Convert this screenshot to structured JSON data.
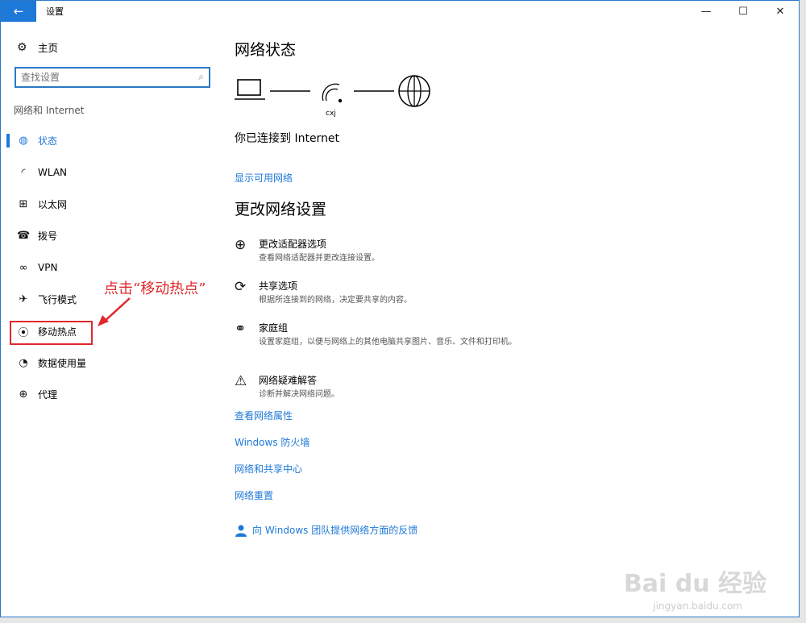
{
  "window": {
    "title": "设置",
    "back": "←",
    "minimize": "—",
    "maximize": "☐",
    "close": "✕"
  },
  "sidebar": {
    "home": "主页",
    "search_placeholder": "查找设置",
    "section": "网络和 Internet",
    "items": [
      {
        "label": "状态",
        "icon": "globe-icon",
        "glyph": "◍",
        "active": true
      },
      {
        "label": "WLAN",
        "icon": "wifi-icon",
        "glyph": "◜",
        "active": false
      },
      {
        "label": "以太网",
        "icon": "ethernet-icon",
        "glyph": "⊞",
        "active": false
      },
      {
        "label": "拨号",
        "icon": "dialup-icon",
        "glyph": "☎",
        "active": false
      },
      {
        "label": "VPN",
        "icon": "vpn-icon",
        "glyph": "∞",
        "active": false
      },
      {
        "label": "飞行模式",
        "icon": "airplane-icon",
        "glyph": "✈",
        "active": false
      },
      {
        "label": "移动热点",
        "icon": "hotspot-icon",
        "glyph": "⦿",
        "active": false
      },
      {
        "label": "数据使用量",
        "icon": "data-usage-icon",
        "glyph": "◔",
        "active": false
      },
      {
        "label": "代理",
        "icon": "proxy-icon",
        "glyph": "⊕",
        "active": false
      }
    ]
  },
  "annotation": {
    "text": "点击“移动热点”"
  },
  "main": {
    "status_title": "网络状态",
    "wifi_name": "cxj",
    "connected_text": "你已连接到 Internet",
    "show_networks": "显示可用网络",
    "change_title": "更改网络设置",
    "settings": [
      {
        "title": "更改适配器选项",
        "desc": "查看网络适配器并更改连接设置。",
        "icon": "adapter-icon",
        "glyph": "⊕"
      },
      {
        "title": "共享选项",
        "desc": "根据所连接到的网络，决定要共享的内容。",
        "icon": "sharing-icon",
        "glyph": "⟳"
      },
      {
        "title": "家庭组",
        "desc": "设置家庭组，以便与网络上的其他电脑共享图片、音乐、文件和打印机。",
        "icon": "homegroup-icon",
        "glyph": "⚭"
      },
      {
        "title": "网络疑难解答",
        "desc": "诊断并解决网络问题。",
        "icon": "warning-icon",
        "glyph": "⚠"
      }
    ],
    "links": [
      "查看网络属性",
      "Windows 防火墙",
      "网络和共享中心",
      "网络重置"
    ],
    "feedback": "向 Windows 团队提供网络方面的反馈"
  },
  "watermark": {
    "brand": "Bai du 经验",
    "url": "jingyan.baidu.com"
  },
  "colors": {
    "accent": "#1e78d7",
    "annotation": "#e0282d"
  }
}
